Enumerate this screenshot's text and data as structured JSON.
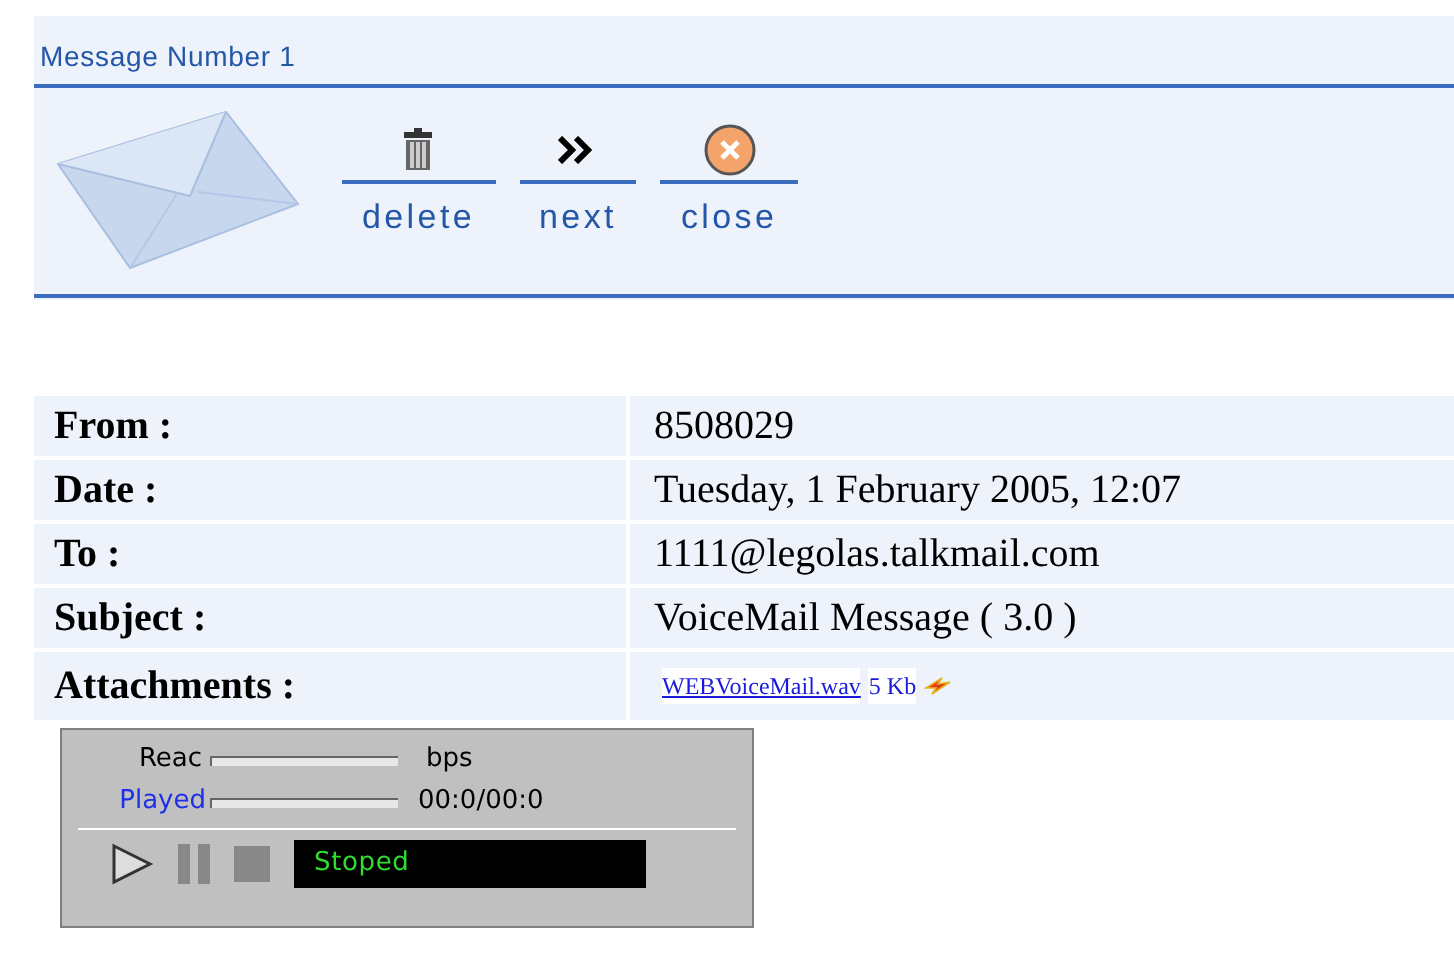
{
  "header": {
    "title": "Message Number 1",
    "actions": [
      {
        "label": "delete",
        "kind": "trash"
      },
      {
        "label": "next",
        "kind": "next"
      },
      {
        "label": "close",
        "kind": "close"
      }
    ]
  },
  "fields": [
    {
      "label": "From :",
      "value": "8508029"
    },
    {
      "label": "Date :",
      "value": "Tuesday, 1 February 2005, 12:07"
    },
    {
      "label": "To :",
      "value": "1111@legolas.talkmail.com"
    },
    {
      "label": "Subject :",
      "value": "VoiceMail Message ( 3.0 )"
    }
  ],
  "attachments": {
    "label": "Attachments :",
    "file": "WEBVoiceMail.wav",
    "size": "5 Kb"
  },
  "player": {
    "received_label": "Reac",
    "received_unit": "bps",
    "played_label": "Played",
    "played_time": "00:0/00:0",
    "status": "Stoped"
  }
}
